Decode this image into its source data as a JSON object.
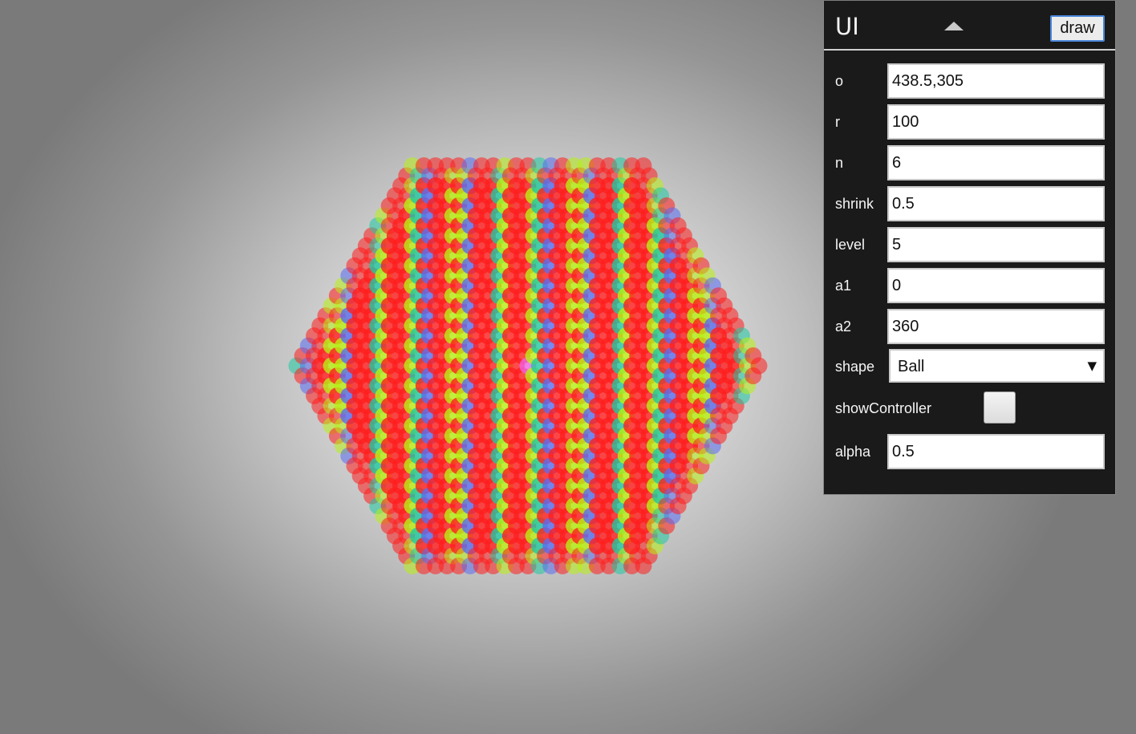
{
  "artwork": {
    "description_shape": "Ball",
    "colors": {
      "red": "#ff1e1e",
      "lime": "#b8f012",
      "teal": "#1fc8a0",
      "blue": "#5a6cf0",
      "magenta": "#f060e0"
    }
  },
  "panel": {
    "title": "UI",
    "collapse_icon": "triangle-up-icon",
    "draw_label": "draw",
    "fields": {
      "o": {
        "label": "o",
        "value": "438.5,305"
      },
      "r": {
        "label": "r",
        "value": "100"
      },
      "n": {
        "label": "n",
        "value": "6"
      },
      "shrink": {
        "label": "shrink",
        "value": "0.5"
      },
      "level": {
        "label": "level",
        "value": "5"
      },
      "a1": {
        "label": "a1",
        "value": "0"
      },
      "a2": {
        "label": "a2",
        "value": "360"
      },
      "shape": {
        "label": "shape",
        "value": "Ball",
        "arrow": "▼"
      },
      "showController": {
        "label": "showController",
        "checked": false
      },
      "alpha": {
        "label": "alpha",
        "value": "0.5"
      }
    }
  }
}
